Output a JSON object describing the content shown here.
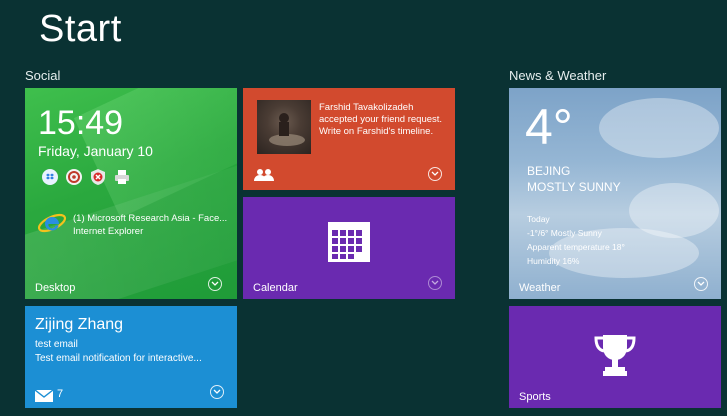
{
  "screen": {
    "title": "Start"
  },
  "groups": {
    "social": "Social",
    "news": "News & Weather"
  },
  "desktop_tile": {
    "time": "15:49",
    "date": "Friday, January 10",
    "notification_line1": "(1) Microsoft Research Asia - Face...",
    "notification_line2": "Internet Explorer",
    "label": "Desktop",
    "icons": [
      "dropbox-icon",
      "network-icon",
      "security-alert-icon",
      "printer-icon",
      "ie-icon"
    ]
  },
  "friend_tile": {
    "text": "Farshid Tavakolizadeh accepted your friend request. Write on Farshid's timeline.",
    "icon": "people-icon"
  },
  "calendar_tile": {
    "label": "Calendar",
    "icon": "calendar-icon"
  },
  "mail_tile": {
    "sender": "Zijing Zhang",
    "subject": "test email",
    "preview": "Test email notification for interactive...",
    "count": "7",
    "icon": "mail-icon"
  },
  "weather_tile": {
    "temperature": "4°",
    "city": "BEJING",
    "condition": "MOSTLY SUNNY",
    "today_label": "Today",
    "range": "-1°/6° Mostly Sunny",
    "apparent": "Apparent temperature 18°",
    "humidity": "Humidity 16%",
    "label": "Weather"
  },
  "sports_tile": {
    "label": "Sports",
    "icon": "trophy-icon"
  },
  "colors": {
    "background": "#0a3233",
    "desktop": "#2aa83e",
    "friend": "#d24a2e",
    "calendar": "#6a2ab0",
    "mail": "#1c8fd4",
    "sports": "#6a2ab0"
  }
}
